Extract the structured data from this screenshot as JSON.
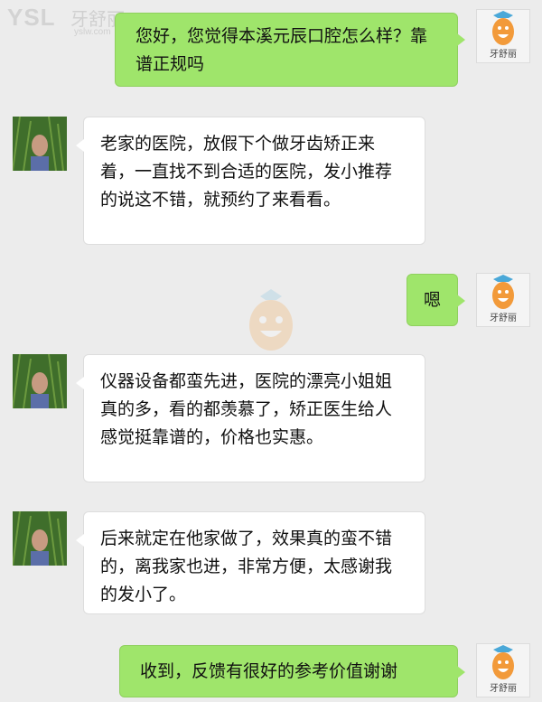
{
  "watermark": {
    "brand": "YSL",
    "brand_cn": "牙舒丽",
    "url": "yslw.com"
  },
  "my_avatar": {
    "label": "牙舒丽",
    "icon": "carrot-mascot-icon"
  },
  "messages": [
    {
      "side": "out",
      "text": "您好，您觉得本溪元辰口腔怎么样？靠谱正规吗"
    },
    {
      "side": "in",
      "text": "老家的医院，放假下个做牙齿矫正来着，一直找不到合适的医院，发小推荐的说这不错，就预约了来看看。"
    },
    {
      "side": "out",
      "text": "嗯"
    },
    {
      "side": "in",
      "text": "仪器设备都蛮先进，医院的漂亮小姐姐真的多，看的都羡慕了，矫正医生给人感觉挺靠谱的，价格也实惠。"
    },
    {
      "side": "in",
      "text": "后来就定在他家做了，效果真的蛮不错的，离我家也进，非常方便，太感谢我的发小了。"
    },
    {
      "side": "out",
      "text": "收到，反馈有很好的参考价值谢谢"
    }
  ],
  "colors": {
    "outgoing_bubble": "#9fe56b",
    "incoming_bubble": "#ffffff",
    "background": "#ececec"
  }
}
